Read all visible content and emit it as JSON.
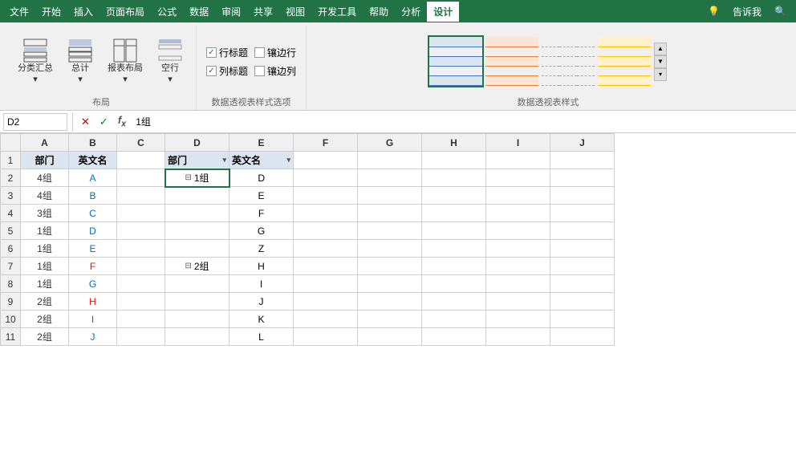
{
  "menu": {
    "items": [
      "文件",
      "开始",
      "插入",
      "页面布局",
      "公式",
      "数据",
      "审阅",
      "共享",
      "视图",
      "开发工具",
      "帮助",
      "分析",
      "设计"
    ],
    "active": "设计",
    "right": [
      "告诉我"
    ],
    "search_icon": "🔍"
  },
  "ribbon": {
    "groups": [
      {
        "name": "布局",
        "buttons": [
          {
            "label": "分类汇总\n▾",
            "icon": "layout1"
          },
          {
            "label": "总计\n▾",
            "icon": "layout2"
          },
          {
            "label": "报表布局\n▾",
            "icon": "layout3"
          },
          {
            "label": "空行\n▾",
            "icon": "layout4"
          }
        ]
      },
      {
        "name": "数据透视表样式选项",
        "checkboxes": [
          {
            "label": "行标题",
            "checked": true
          },
          {
            "label": "镶边行",
            "checked": false
          },
          {
            "label": "列标题",
            "checked": true
          },
          {
            "label": "镶边列",
            "checked": false
          }
        ]
      },
      {
        "name": "数据透视表样式",
        "styles": [
          {
            "id": "style1",
            "selected": true
          },
          {
            "id": "style2",
            "selected": false
          },
          {
            "id": "style3",
            "selected": false
          },
          {
            "id": "style4",
            "selected": false
          }
        ]
      }
    ]
  },
  "formula_bar": {
    "cell_ref": "D2",
    "formula": "1组"
  },
  "sheet": {
    "col_headers": [
      "",
      "A",
      "B",
      "C",
      "D",
      "E",
      "F",
      "G",
      "H",
      "I",
      "J"
    ],
    "rows": [
      {
        "row": 1,
        "cells": [
          "部门",
          "英文名",
          "",
          "部门",
          "英文名",
          "",
          "",
          "",
          "",
          ""
        ]
      },
      {
        "row": 2,
        "cells": [
          "4组",
          "A",
          "",
          "□1组",
          "D",
          "",
          "",
          "",
          "",
          ""
        ]
      },
      {
        "row": 3,
        "cells": [
          "4组",
          "B",
          "",
          "",
          "E",
          "",
          "",
          "",
          "",
          ""
        ]
      },
      {
        "row": 4,
        "cells": [
          "3组",
          "C",
          "",
          "",
          "F",
          "",
          "",
          "",
          "",
          ""
        ]
      },
      {
        "row": 5,
        "cells": [
          "1组",
          "D",
          "",
          "",
          "G",
          "",
          "",
          "",
          "",
          ""
        ]
      },
      {
        "row": 6,
        "cells": [
          "1组",
          "E",
          "",
          "",
          "Z",
          "",
          "",
          "",
          "",
          ""
        ]
      },
      {
        "row": 7,
        "cells": [
          "1组",
          "F",
          "",
          "□2组",
          "H",
          "",
          "",
          "",
          "",
          ""
        ]
      },
      {
        "row": 8,
        "cells": [
          "1组",
          "G",
          "",
          "",
          "I",
          "",
          "",
          "",
          "",
          ""
        ]
      },
      {
        "row": 9,
        "cells": [
          "2组",
          "H",
          "",
          "",
          "J",
          "",
          "",
          "",
          "",
          ""
        ]
      },
      {
        "row": 10,
        "cells": [
          "2组",
          "I",
          "",
          "",
          "K",
          "",
          "",
          "",
          "",
          ""
        ]
      },
      {
        "row": 11,
        "cells": [
          "2组",
          "J",
          "",
          "",
          "L",
          "",
          "",
          "",
          "",
          ""
        ]
      }
    ],
    "cell_colors": {
      "A2": "normal",
      "A3": "normal",
      "A4": "normal",
      "A5": "normal",
      "A6": "normal",
      "A7": "normal",
      "A8": "normal",
      "B2": "blue",
      "B3": "blue",
      "B4": "blue",
      "B5": "blue",
      "B6": "blue",
      "B7": "red",
      "B8": "blue",
      "B9": "red",
      "B10": "blue",
      "B11": "blue"
    }
  }
}
